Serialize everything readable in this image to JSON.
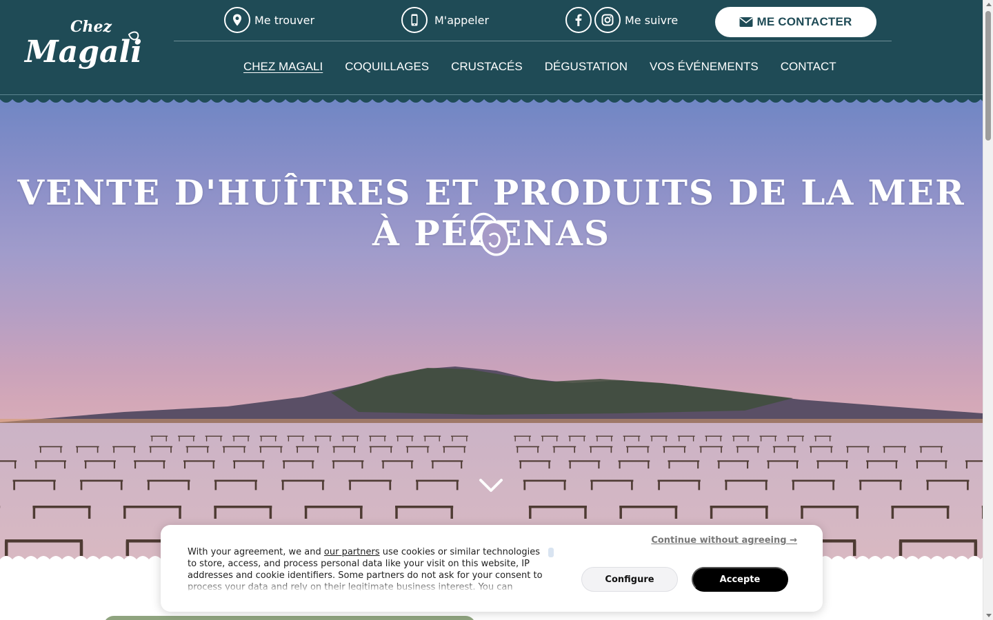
{
  "header": {
    "logo_text_top": "Chez",
    "logo_text_main": "Magali",
    "topbar": {
      "find_label": "Me trouver",
      "call_label": "M'appeler",
      "follow_label": "Me suivre",
      "contact_label": "ME CONTACTER"
    },
    "nav": [
      {
        "label": "CHEZ MAGALI"
      },
      {
        "label": "COQUILLAGES"
      },
      {
        "label": "CRUSTACÉS"
      },
      {
        "label": "DÉGUSTATION"
      },
      {
        "label": "VOS ÉVÉNEMENTS"
      },
      {
        "label": "CONTACT"
      }
    ]
  },
  "hero": {
    "title": "VENTE D'HUÎTRES ET PRODUITS DE LA MER À PÉZENAS"
  },
  "cookie": {
    "text_before": "With your agreement, we and ",
    "partners_link": "our partners",
    "text_after": " use cookies or similar technologies to store, access, and process personal data like your visit on this website, IP addresses and cookie identifiers. Some partners do not ask for your consent to process your data and rely on their legitimate business interest. You can",
    "continue_label": "Continue without agreeing →",
    "configure_label": "Configure",
    "accept_label": "Accepte"
  },
  "icons": {
    "find": "location-pin-icon",
    "call": "smartphone-icon",
    "facebook": "facebook-icon",
    "instagram": "instagram-icon",
    "contact": "envelope-icon",
    "hero": "oyster-icon",
    "scroll": "chevron-down-icon"
  },
  "colors": {
    "header_bg": "#1f4b56",
    "accept_bg": "#000000",
    "link_gray": "#777777"
  }
}
